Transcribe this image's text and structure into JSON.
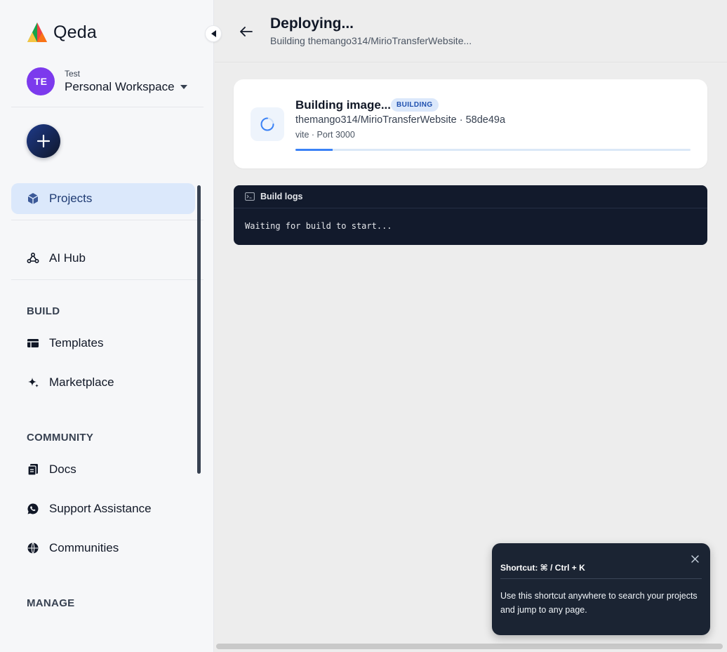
{
  "app": {
    "name": "Qeda"
  },
  "workspace": {
    "initials": "TE",
    "label": "Test",
    "name": "Personal Workspace"
  },
  "sidebar": {
    "primary": [
      {
        "label": "Projects",
        "icon": "cube-icon",
        "active": true
      },
      {
        "label": "AI Hub",
        "icon": "webhook-icon",
        "active": false
      }
    ],
    "sections": [
      {
        "title": "BUILD",
        "items": [
          {
            "label": "Templates",
            "icon": "table-icon"
          },
          {
            "label": "Marketplace",
            "icon": "sparkle-icon"
          }
        ]
      },
      {
        "title": "COMMUNITY",
        "items": [
          {
            "label": "Docs",
            "icon": "docs-icon"
          },
          {
            "label": "Support Assistance",
            "icon": "whatsapp-icon"
          },
          {
            "label": "Communities",
            "icon": "globe-icon"
          }
        ]
      },
      {
        "title": "MANAGE",
        "items": []
      }
    ]
  },
  "header": {
    "title": "Deploying...",
    "subtitle": "Building themango314/MirioTransferWebsite..."
  },
  "deploy_card": {
    "status_title": "Building image...",
    "badge": "BUILDING",
    "repo_line": "themango314/MirioTransferWebsite · 58de49a",
    "meta": "vite · Port 3000",
    "progress_fraction": 0.095
  },
  "build_logs": {
    "title": "Build logs",
    "text": "Waiting for build to start..."
  },
  "toast": {
    "title": "Shortcut: ⌘ / Ctrl + K",
    "body": "Use this shortcut anywhere to search your projects and jump to any page."
  },
  "colors": {
    "accent": "#3b82f6",
    "active_nav_bg": "#dbe8fb",
    "avatar": "#7c3aed",
    "logs_bg": "#121a2c"
  }
}
